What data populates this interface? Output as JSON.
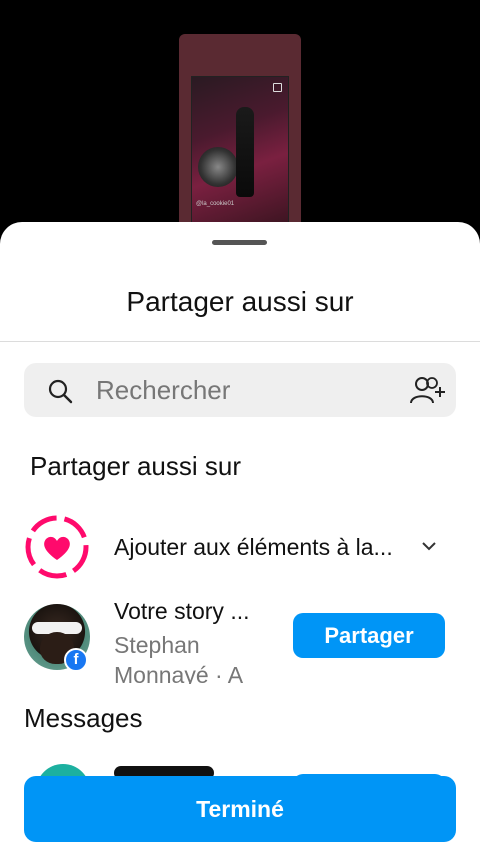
{
  "story_preview": {
    "handle": "@la_cookie01"
  },
  "sheet": {
    "title": "Partager aussi sur"
  },
  "search": {
    "placeholder": "Rechercher"
  },
  "share_section": {
    "title": "Partager aussi sur",
    "highlights_label": "Ajouter aux éléments à la...",
    "story": {
      "title": "Votre story ...",
      "subtitle": "Stephan Monnayé · A",
      "button": "Partager"
    }
  },
  "messages": {
    "title": "Messages"
  },
  "footer": {
    "done_label": "Terminé"
  },
  "colors": {
    "accent": "#0095f6",
    "highlight": "#ff0a6c",
    "facebook": "#1877f2"
  }
}
